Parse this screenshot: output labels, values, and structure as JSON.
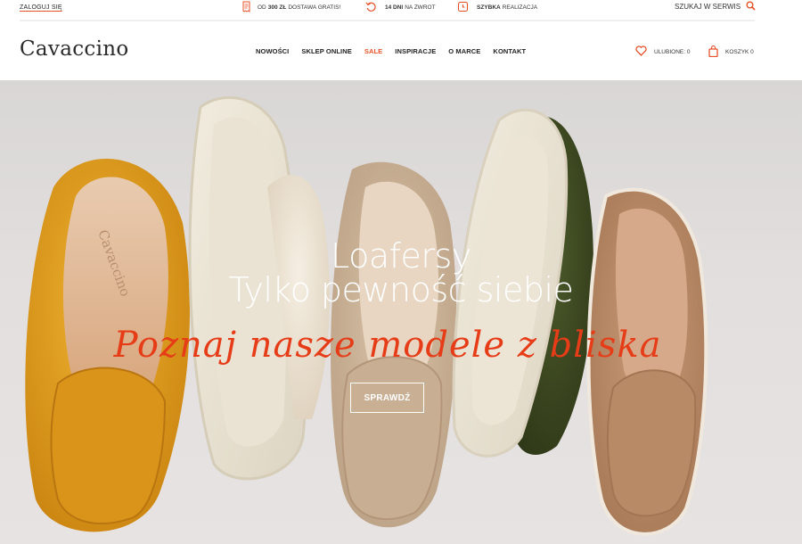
{
  "topbar": {
    "login": "ZALOGUJ SIĘ",
    "perk1": {
      "pre": "OD",
      "bold": "300 ZŁ",
      "post": "DOSTAWA GRATIS!"
    },
    "perk2": {
      "bold": "14 DNI",
      "post": "NA ZWROT"
    },
    "perk3": {
      "bold": "SZYBKA",
      "post": "REALIZACJA"
    },
    "search_label": "SZUKAJ W SERWIS"
  },
  "header": {
    "logo": "Cavaccino",
    "nav": [
      "NOWOŚCI",
      "SKLEP ONLINE",
      "SALE",
      "INSPIRACJE",
      "O MARCE",
      "KONTAKT"
    ],
    "favorites": "ULUBIONE: 0",
    "cart": "KOSZYK 0"
  },
  "hero": {
    "line1": "Loafersy",
    "line2": "Tylko pewność siebie",
    "line3": "Poznaj nasze modele z bliska",
    "cta": "SPRAWDŹ",
    "insole_brand": "Cavaccino"
  },
  "colors": {
    "accent": "#e8502a",
    "hero_script": "#e63c17",
    "shoe_yellow": "#e3a21a",
    "shoe_cream": "#ece3d2",
    "shoe_beige": "#cdb59a",
    "shoe_olive": "#3f4a22",
    "shoe_tan": "#b88a68"
  }
}
